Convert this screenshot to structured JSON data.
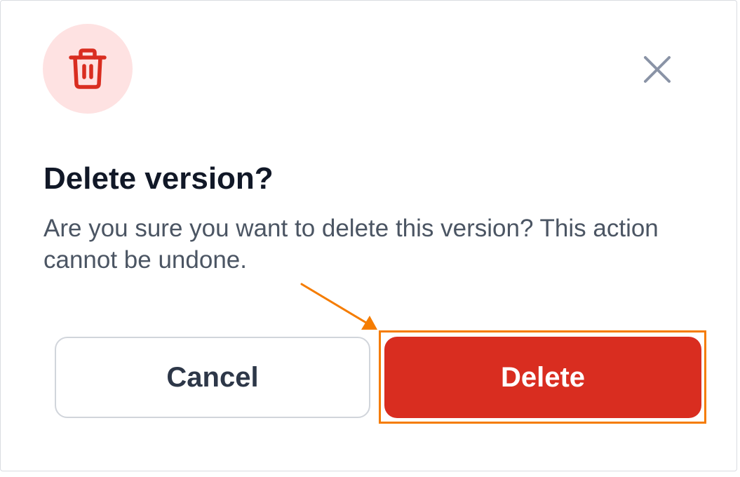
{
  "dialog": {
    "title": "Delete version?",
    "message": "Are you sure you want to delete this version? This action cannot be undone.",
    "icon": "trash-icon",
    "close_icon": "close-icon",
    "cancel_label": "Cancel",
    "delete_label": "Delete"
  },
  "colors": {
    "danger": "#d92d20",
    "danger_bg": "#fee2e2",
    "title": "#111827",
    "text": "#4b5563",
    "annotation": "#f57c00"
  }
}
